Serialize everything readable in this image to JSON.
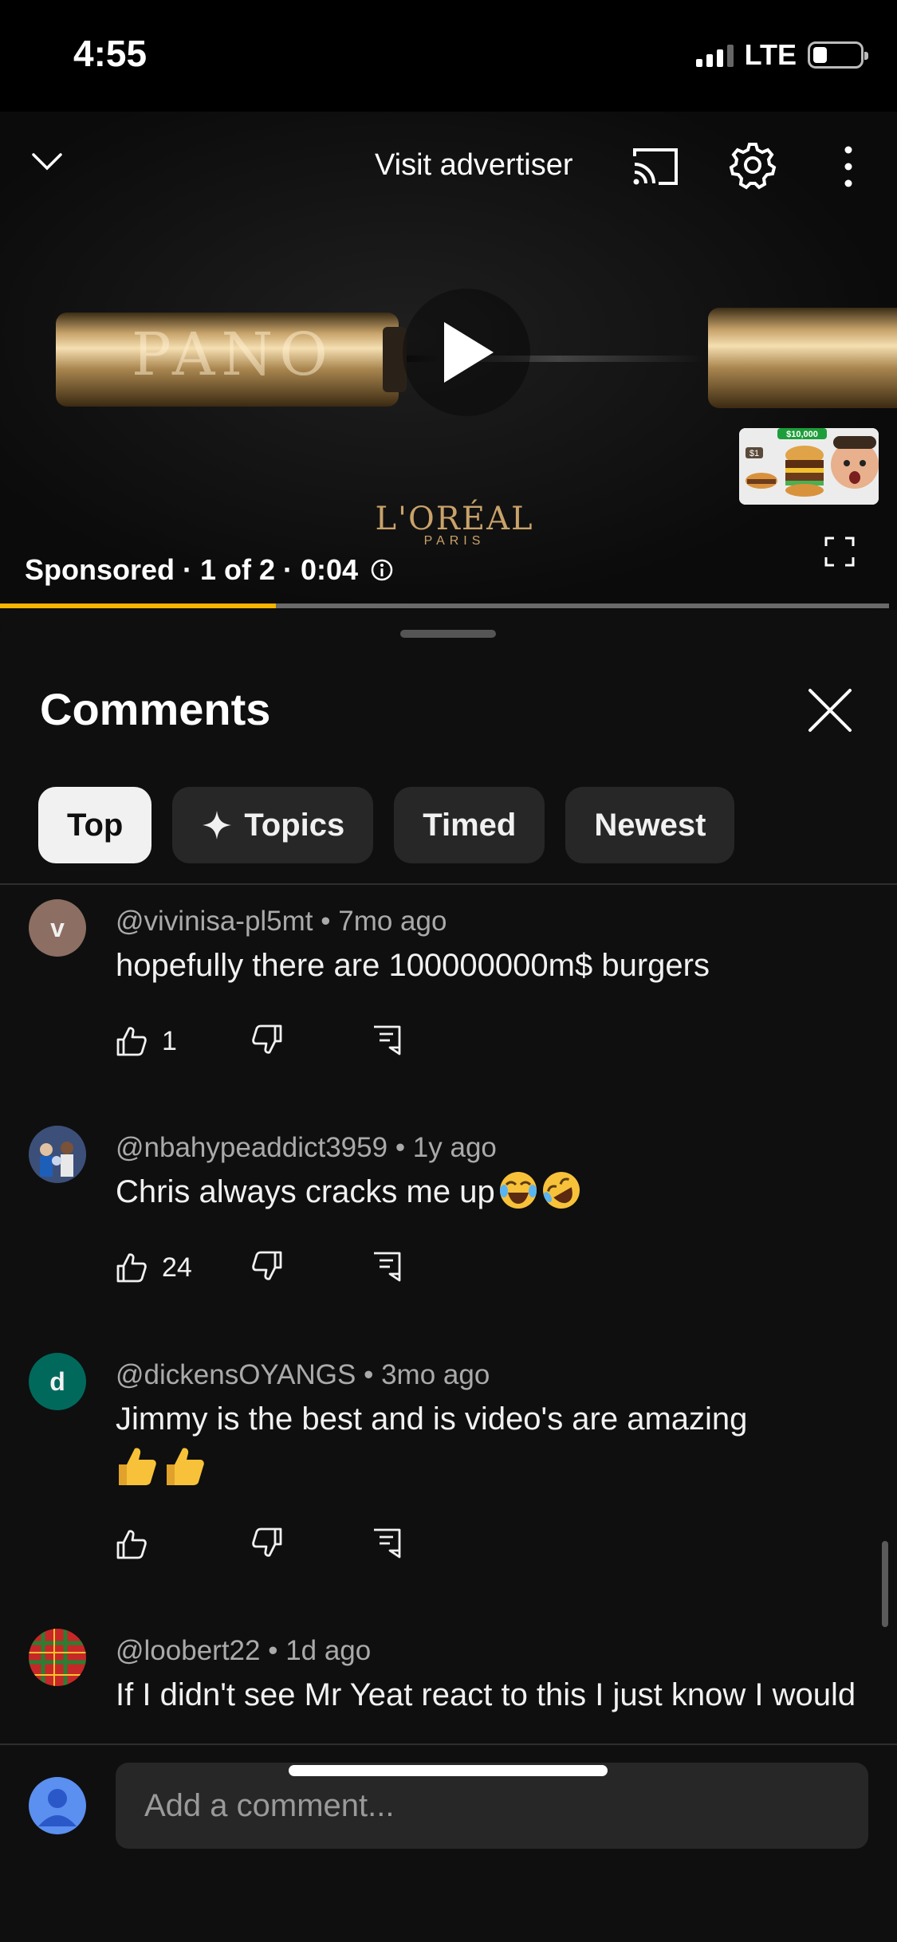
{
  "status_bar": {
    "time": "4:55",
    "network": "LTE",
    "battery_level": 0.3
  },
  "player": {
    "visit_advertiser": "Visit advertiser",
    "sponsored_text": "Sponsored · 1 of 2 · 0:04",
    "brand_name": "L'ORÉAL",
    "brand_sub": "PARIS",
    "product_text": "PANO",
    "progress": 0.31,
    "accent_color": "#f5b400",
    "icons": [
      "chevron-down-icon",
      "cast-icon",
      "gear-icon",
      "more-vert-icon",
      "play-icon",
      "fullscreen-icon",
      "info-icon"
    ]
  },
  "comments_panel": {
    "title": "Comments",
    "chips": [
      {
        "label": "Top",
        "active": true
      },
      {
        "label": "Topics",
        "icon": "sparkle-icon"
      },
      {
        "label": "Timed"
      },
      {
        "label": "Newest"
      }
    ],
    "comments": [
      {
        "avatar_letter": "v",
        "avatar_color": "#8d6e63",
        "author": "@vivinisa-pl5mt",
        "time": "7mo ago",
        "text": "hopefully there are 100000000m$ burgers",
        "likes": "1"
      },
      {
        "avatar_letter": "",
        "author": "@nbahypeaddict3959",
        "time": "1y ago",
        "text": "Chris always cracks me up",
        "emoji": [
          "face-with-tears-of-joy",
          "rolling-on-the-floor-laughing"
        ],
        "likes": "24"
      },
      {
        "avatar_letter": "d",
        "avatar_color": "#00695c",
        "author": "@dickensOYANGS",
        "time": "3mo ago",
        "text": "Jimmy is the best and is video's are amazing",
        "emoji": [
          "thumbs-up",
          "thumbs-up"
        ],
        "likes": ""
      },
      {
        "avatar_letter": "",
        "author": "@loobert22",
        "time": "1d ago",
        "text": "If I didn't see Mr Yeat react to this I just know I would never haave achived my memes. Thank",
        "likes": ""
      }
    ],
    "composer_placeholder": "Add a comment..."
  }
}
